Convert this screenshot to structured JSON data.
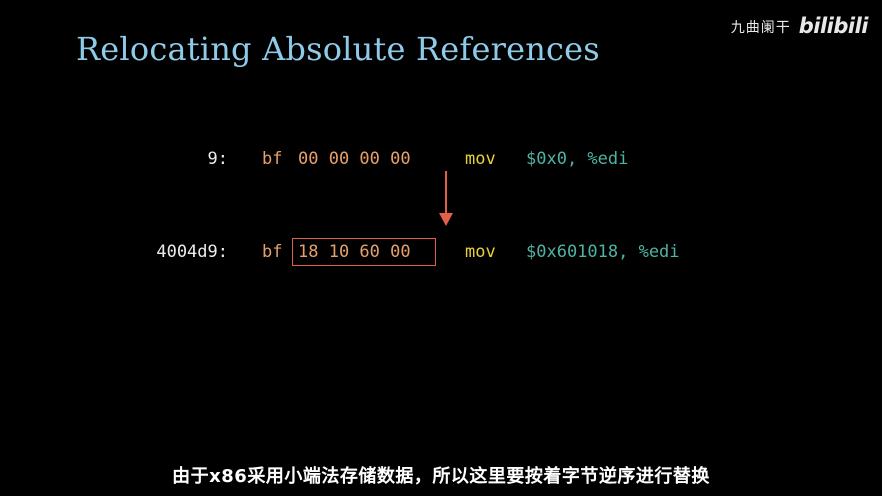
{
  "slide": {
    "title": "Relocating Absolute References",
    "title_color": "#8ecbe8"
  },
  "watermark": {
    "author": "九曲阑干",
    "logo_text": "bilibili"
  },
  "instructions": [
    {
      "address": "9:",
      "opcode": "bf",
      "immediate": "00 00 00 00",
      "mnemonic": "mov",
      "operands": "$0x0, %edi"
    },
    {
      "address": "4004d9:",
      "opcode": "bf",
      "immediate": "18 10 60 00",
      "mnemonic": "mov",
      "operands": "$0x601018, %edi"
    }
  ],
  "colors": {
    "opcode": "#e8a06a",
    "mnemonic": "#e8d23a",
    "operand": "#4fb3a4",
    "highlight": "#e25f4a"
  },
  "subtitle": "由于x86采用小端法存储数据，所以这里要按着字节逆序进行替换"
}
